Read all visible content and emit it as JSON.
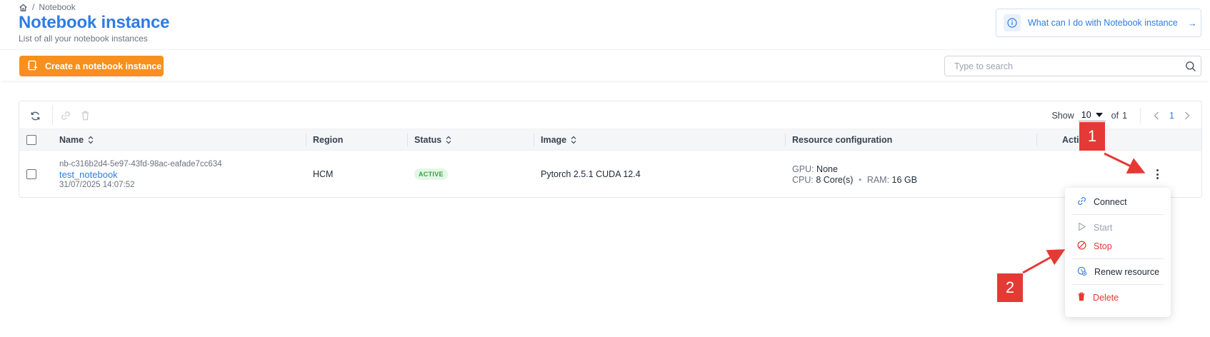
{
  "breadcrumb": {
    "current": "Notebook"
  },
  "header": {
    "title": "Notebook instance",
    "subtitle": "List of all your notebook instances",
    "help_text": "What can I do with Notebook instance",
    "help_arrow": "→"
  },
  "toolbar": {
    "create_label": "Create a notebook instance",
    "search_placeholder": "Type to search"
  },
  "table": {
    "pager": {
      "show_label": "Show",
      "page_size": "10",
      "of_label": "of",
      "total_pages": "1",
      "current_page": "1"
    },
    "columns": {
      "name": "Name",
      "region": "Region",
      "status": "Status",
      "image": "Image",
      "resource": "Resource configuration",
      "action": "Action"
    },
    "rows": [
      {
        "id": "nb-c316b2d4-5e97-43fd-98ac-eafade7cc634",
        "name": "test_notebook",
        "created": "31/07/2025 14:07:52",
        "region": "HCM",
        "status": "ACTIVE",
        "image": "Pytorch 2.5.1 CUDA 12.4",
        "gpu_label": "GPU:",
        "gpu_value": "None",
        "cpu_label": "CPU:",
        "cpu_value": "8 Core(s)",
        "ram_label": "RAM:",
        "ram_value": "16 GB"
      }
    ]
  },
  "menu": {
    "items": [
      {
        "label": "Connect",
        "state": "enabled"
      },
      {
        "label": "Start",
        "state": "disabled"
      },
      {
        "label": "Stop",
        "state": "danger"
      },
      {
        "label": "Renew resource",
        "state": "enabled"
      },
      {
        "label": "Delete",
        "state": "danger"
      }
    ]
  },
  "annotations": {
    "one": "1",
    "two": "2"
  },
  "colors": {
    "primary": "#2f7ce3",
    "accent_orange": "#f7901e",
    "danger": "#e53935",
    "status_active_bg": "#e3f7e5",
    "status_active_text": "#2fa745",
    "annotation": "#e53935"
  },
  "icons": [
    "home-icon",
    "info-icon",
    "arrow-right-icon",
    "notebook-icon",
    "search-icon",
    "refresh-icon",
    "link-icon",
    "trash-icon",
    "caret-down-icon",
    "chevron-left-icon",
    "chevron-right-icon",
    "sort-icon",
    "kebab-icon",
    "link-icon",
    "play-icon",
    "stop-icon",
    "renew-icon",
    "trash-icon"
  ]
}
